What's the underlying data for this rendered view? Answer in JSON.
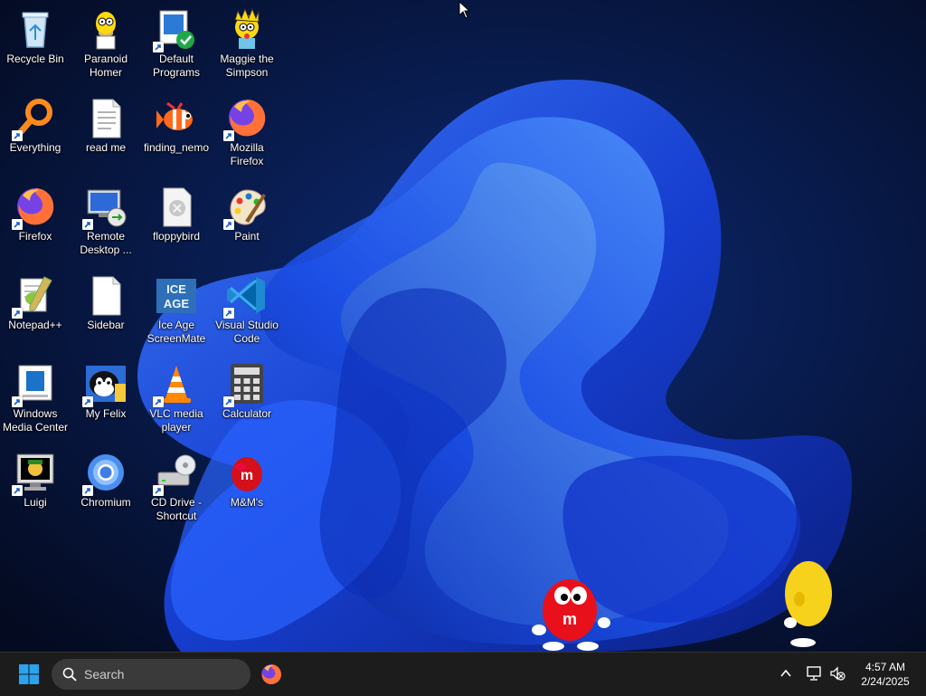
{
  "desktop": {
    "icons": [
      {
        "label": "Recycle Bin",
        "icon": "recycle-bin-icon"
      },
      {
        "label": "Paranoid\nHomer",
        "icon": "homer-icon"
      },
      {
        "label": "Default\nPrograms",
        "icon": "default-programs-icon"
      },
      {
        "label": "Maggie the\nSimpson",
        "icon": "maggie-icon"
      },
      {
        "label": "Everything",
        "icon": "everything-search-icon"
      },
      {
        "label": "read me",
        "icon": "text-document-icon"
      },
      {
        "label": "finding_nemo",
        "icon": "nemo-fish-icon"
      },
      {
        "label": "Mozilla\nFirefox",
        "icon": "firefox-icon"
      },
      {
        "label": "Firefox",
        "icon": "firefox-icon"
      },
      {
        "label": "Remote\nDesktop ...",
        "icon": "remote-desktop-icon"
      },
      {
        "label": "floppybird",
        "icon": "generic-file-icon"
      },
      {
        "label": "Paint",
        "icon": "paint-palette-icon"
      },
      {
        "label": "Notepad++",
        "icon": "notepad-plus-plus-icon"
      },
      {
        "label": "Sidebar",
        "icon": "blank-document-icon"
      },
      {
        "label": "Ice Age\nScreenMate",
        "icon": "ice-age-icon"
      },
      {
        "label": "Visual Studio\nCode",
        "icon": "vscode-icon"
      },
      {
        "label": "Windows\nMedia Center",
        "icon": "media-center-icon"
      },
      {
        "label": "My Felix",
        "icon": "felix-cat-icon"
      },
      {
        "label": "VLC media\nplayer",
        "icon": "vlc-cone-icon"
      },
      {
        "label": "Calculator",
        "icon": "calculator-icon"
      },
      {
        "label": "Luigi",
        "icon": "luigi-monitor-icon"
      },
      {
        "label": "Chromium",
        "icon": "chromium-icon"
      },
      {
        "label": "CD Drive -\nShortcut",
        "icon": "cd-drive-icon"
      },
      {
        "label": "M&M's",
        "icon": "mm-candy-icon"
      }
    ]
  },
  "taskbar": {
    "search_placeholder": "Search",
    "pinned": [
      "firefox-icon"
    ],
    "clock_time": "4:57 AM",
    "clock_date": "2/24/2025"
  },
  "colors": {
    "wallpaper_dark": "#050d24",
    "bloom_blue": "#1f56e8",
    "taskbar": "#1c1c1c",
    "search_box": "#3a3a3a"
  }
}
